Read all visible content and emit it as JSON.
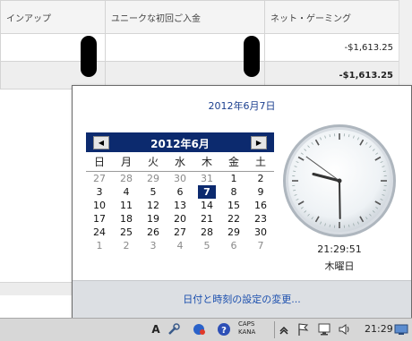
{
  "table": {
    "headers": [
      "インアップ",
      "ユニークな初回ご入金",
      "ネット・ゲーミング"
    ],
    "rows": [
      [
        "",
        "",
        "-$1,613.25"
      ],
      [
        "",
        "",
        "-$1,613.25"
      ]
    ]
  },
  "popup": {
    "date_header": "2012年6月7日",
    "calendar": {
      "month_label": "2012年6月",
      "prev_icon": "◀",
      "next_icon": "▶",
      "weekdays": [
        "日",
        "月",
        "火",
        "水",
        "木",
        "金",
        "土"
      ],
      "weeks": [
        [
          "27",
          "28",
          "29",
          "30",
          "31",
          "1",
          "2"
        ],
        [
          "3",
          "4",
          "5",
          "6",
          "7",
          "8",
          "9"
        ],
        [
          "10",
          "11",
          "12",
          "13",
          "14",
          "15",
          "16"
        ],
        [
          "17",
          "18",
          "19",
          "20",
          "21",
          "22",
          "23"
        ],
        [
          "24",
          "25",
          "26",
          "27",
          "28",
          "29",
          "30"
        ],
        [
          "1",
          "2",
          "3",
          "4",
          "5",
          "6",
          "7"
        ]
      ],
      "selected_day": "7"
    },
    "clock": {
      "time": "21:29:51",
      "weekday": "木曜日",
      "hour": 21,
      "minute": 29,
      "second": 51
    },
    "footer_link": "日付と時刻の設定の変更..."
  },
  "taskbar": {
    "ime_label": "A",
    "caps_label": "CAPS",
    "kana_label": "KANA",
    "clock_time": "21:29",
    "icons": [
      "ime-a-icon",
      "tools-icon",
      "ime-status-icon",
      "help-icon",
      "show-hidden-icon",
      "flag-icon",
      "network-icon",
      "volume-icon",
      "desktop-icon"
    ]
  }
}
